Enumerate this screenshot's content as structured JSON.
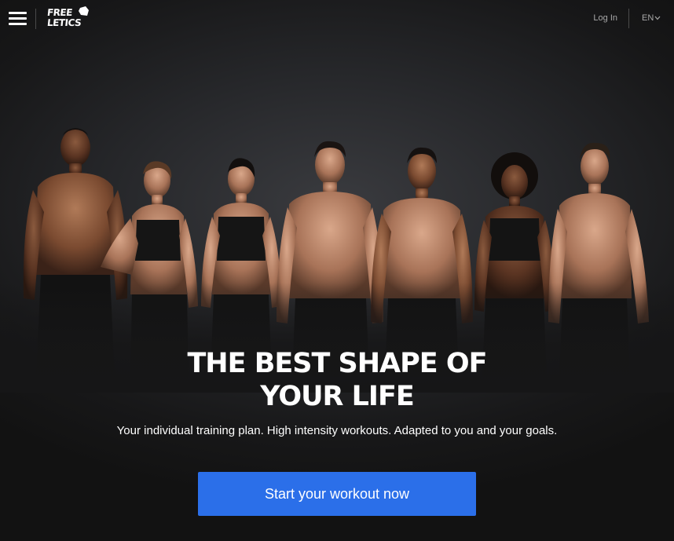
{
  "header": {
    "logo": {
      "line1": "FREE",
      "line2": "LETICS"
    },
    "menu_icon": "hamburger-menu-icon",
    "login_label": "Log In",
    "language": {
      "selected": "EN",
      "icon": "chevron-down-icon"
    }
  },
  "hero": {
    "title_line1": "THE BEST SHAPE OF",
    "title_line2": "YOUR LIFE",
    "subtitle": "Your individual training plan. High intensity workouts. Adapted to you and your goals.",
    "cta_label": "Start your workout now"
  },
  "colors": {
    "background": "#161616",
    "cta": "#2b6fe9",
    "header_text": "#a8a8a8",
    "text": "#ffffff"
  }
}
